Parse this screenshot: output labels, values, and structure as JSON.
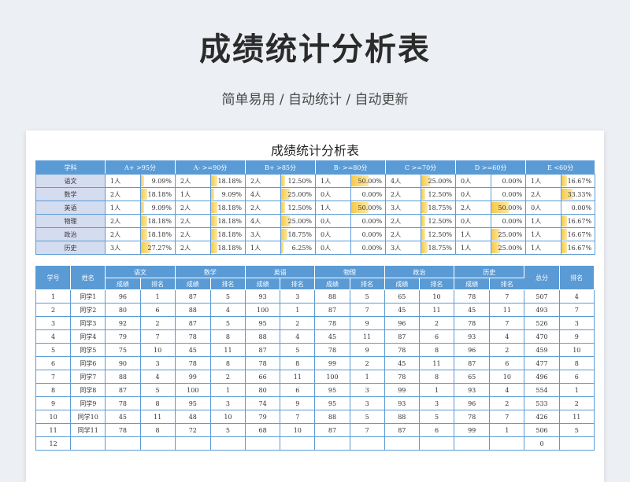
{
  "hero": {
    "title": "成绩统计分析表",
    "subtitle": "简单易用  /  自动统计  /  自动更新"
  },
  "sheet_title": "成绩统计分析表",
  "stats": {
    "headers": [
      "学科",
      "A+ >95分",
      "A- >=90分",
      "B+ >85分",
      "B- >=80分",
      "C >=70分",
      "D >=60分",
      "E <60分"
    ],
    "rows": [
      {
        "subject": "语文",
        "cells": [
          [
            "1人",
            "9.09%"
          ],
          [
            "2人",
            "18.18%"
          ],
          [
            "2人",
            "12.50%"
          ],
          [
            "1人",
            "50.00%"
          ],
          [
            "4人",
            "25.00%"
          ],
          [
            "0人",
            "0.00%"
          ],
          [
            "1人",
            "16.67%"
          ]
        ]
      },
      {
        "subject": "数学",
        "cells": [
          [
            "2人",
            "18.18%"
          ],
          [
            "1人",
            "9.09%"
          ],
          [
            "4人",
            "25.00%"
          ],
          [
            "0人",
            "0.00%"
          ],
          [
            "2人",
            "12.50%"
          ],
          [
            "0人",
            "0.00%"
          ],
          [
            "2人",
            "33.33%"
          ]
        ]
      },
      {
        "subject": "英语",
        "cells": [
          [
            "1人",
            "9.09%"
          ],
          [
            "2人",
            "18.18%"
          ],
          [
            "2人",
            "12.50%"
          ],
          [
            "1人",
            "50.00%"
          ],
          [
            "3人",
            "18.75%"
          ],
          [
            "2人",
            "50.00%"
          ],
          [
            "0人",
            "0.00%"
          ]
        ]
      },
      {
        "subject": "物理",
        "cells": [
          [
            "2人",
            "18.18%"
          ],
          [
            "2人",
            "18.18%"
          ],
          [
            "4人",
            "25.00%"
          ],
          [
            "0人",
            "0.00%"
          ],
          [
            "2人",
            "12.50%"
          ],
          [
            "0人",
            "0.00%"
          ],
          [
            "1人",
            "16.67%"
          ]
        ]
      },
      {
        "subject": "政治",
        "cells": [
          [
            "2人",
            "18.18%"
          ],
          [
            "2人",
            "18.18%"
          ],
          [
            "3人",
            "18.75%"
          ],
          [
            "0人",
            "0.00%"
          ],
          [
            "2人",
            "12.50%"
          ],
          [
            "1人",
            "25.00%"
          ],
          [
            "1人",
            "16.67%"
          ]
        ]
      },
      {
        "subject": "历史",
        "cells": [
          [
            "3人",
            "27.27%"
          ],
          [
            "2人",
            "18.18%"
          ],
          [
            "1人",
            "6.25%"
          ],
          [
            "0人",
            "0.00%"
          ],
          [
            "3人",
            "18.75%"
          ],
          [
            "1人",
            "25.00%"
          ],
          [
            "1人",
            "16.67%"
          ]
        ]
      }
    ]
  },
  "scores": {
    "col_no": "学号",
    "col_name": "姓名",
    "subjects": [
      "语文",
      "数学",
      "英语",
      "物理",
      "政治",
      "历史"
    ],
    "sub_score": "成绩",
    "sub_rank": "排名",
    "col_total": "总分",
    "col_rank": "排名",
    "rows": [
      {
        "no": "1",
        "name": "同学1",
        "vals": [
          "96",
          "1",
          "87",
          "5",
          "93",
          "3",
          "88",
          "5",
          "65",
          "10",
          "78",
          "7"
        ],
        "total": "507",
        "rank": "4"
      },
      {
        "no": "2",
        "name": "同学2",
        "vals": [
          "80",
          "6",
          "88",
          "4",
          "100",
          "1",
          "87",
          "7",
          "45",
          "11",
          "45",
          "11"
        ],
        "total": "493",
        "rank": "7"
      },
      {
        "no": "3",
        "name": "同学3",
        "vals": [
          "92",
          "2",
          "87",
          "5",
          "95",
          "2",
          "78",
          "9",
          "96",
          "2",
          "78",
          "7"
        ],
        "total": "526",
        "rank": "3"
      },
      {
        "no": "4",
        "name": "同学4",
        "vals": [
          "79",
          "7",
          "78",
          "8",
          "88",
          "4",
          "45",
          "11",
          "87",
          "6",
          "93",
          "4"
        ],
        "total": "470",
        "rank": "9"
      },
      {
        "no": "5",
        "name": "同学5",
        "vals": [
          "75",
          "10",
          "45",
          "11",
          "87",
          "5",
          "78",
          "9",
          "78",
          "8",
          "96",
          "2"
        ],
        "total": "459",
        "rank": "10"
      },
      {
        "no": "6",
        "name": "同学6",
        "vals": [
          "90",
          "3",
          "78",
          "8",
          "78",
          "8",
          "99",
          "2",
          "45",
          "11",
          "87",
          "6"
        ],
        "total": "477",
        "rank": "8"
      },
      {
        "no": "7",
        "name": "同学7",
        "vals": [
          "88",
          "4",
          "99",
          "2",
          "66",
          "11",
          "100",
          "1",
          "78",
          "8",
          "65",
          "10"
        ],
        "total": "496",
        "rank": "6"
      },
      {
        "no": "8",
        "name": "同学8",
        "vals": [
          "87",
          "5",
          "100",
          "1",
          "80",
          "6",
          "95",
          "3",
          "99",
          "1",
          "93",
          "4"
        ],
        "total": "554",
        "rank": "1"
      },
      {
        "no": "9",
        "name": "同学9",
        "vals": [
          "78",
          "8",
          "95",
          "3",
          "74",
          "9",
          "95",
          "3",
          "93",
          "3",
          "96",
          "2"
        ],
        "total": "533",
        "rank": "2"
      },
      {
        "no": "10",
        "name": "同学10",
        "vals": [
          "45",
          "11",
          "48",
          "10",
          "79",
          "7",
          "88",
          "5",
          "88",
          "5",
          "78",
          "7"
        ],
        "total": "426",
        "rank": "11"
      },
      {
        "no": "11",
        "name": "同学11",
        "vals": [
          "78",
          "8",
          "72",
          "5",
          "68",
          "10",
          "87",
          "7",
          "87",
          "6",
          "99",
          "1"
        ],
        "total": "506",
        "rank": "5"
      },
      {
        "no": "12",
        "name": "",
        "vals": [
          "",
          "",
          "",
          "",
          "",
          "",
          "",
          "",
          "",
          "",
          "",
          ""
        ],
        "total": "0",
        "rank": ""
      }
    ]
  },
  "colors": {
    "header_blue": "#5b9bd5",
    "subject_bg": "#d4dcef",
    "bar_yellow": "#f7c948",
    "page_bg": "#eceff3"
  }
}
